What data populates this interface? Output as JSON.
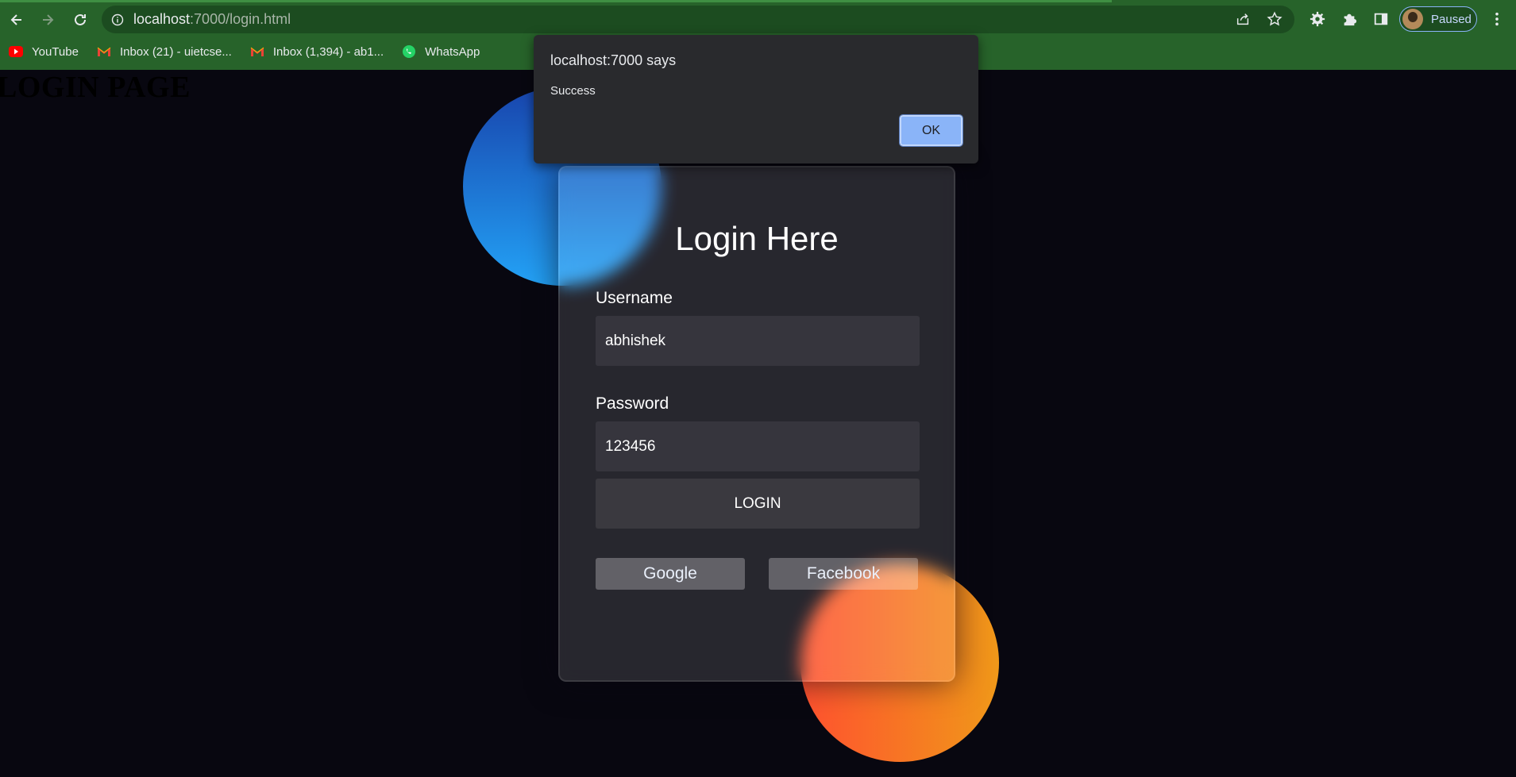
{
  "browser": {
    "url_host": "localhost",
    "url_path": ":7000/login.html",
    "profile_label": "Paused",
    "bookmarks": [
      {
        "label": "YouTube",
        "icon": "youtube-icon"
      },
      {
        "label": "Inbox (21) - uietcse...",
        "icon": "gmail-icon"
      },
      {
        "label": "Inbox (1,394) - ab1...",
        "icon": "gmail-icon"
      },
      {
        "label": "WhatsApp",
        "icon": "whatsapp-icon"
      }
    ]
  },
  "page": {
    "heading": "LOGIN PAGE"
  },
  "form": {
    "title": "Login Here",
    "username_label": "Username",
    "username_value": "abhishek",
    "password_label": "Password",
    "password_value": "123456",
    "login_label": "LOGIN",
    "google_label": "Google",
    "facebook_label": "Facebook"
  },
  "alert": {
    "title": "localhost:7000 says",
    "message": "Success",
    "ok_label": "OK"
  },
  "colors": {
    "chrome": "#27632a",
    "background": "#080710",
    "accent": "#8ab4f8",
    "shape_blue": "#1845ad",
    "shape_orange": "#ff512f"
  }
}
